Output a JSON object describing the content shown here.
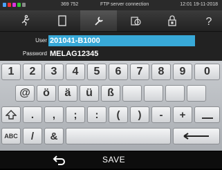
{
  "status": {
    "counter": "369 752",
    "title": "FTP server connection",
    "clock": "12:01  19-11-2018",
    "led_colors": [
      "#4aa3ff",
      "#e33",
      "#d3d",
      "#3c3",
      "#888"
    ]
  },
  "tabs": [
    {
      "icon": "program-icon"
    },
    {
      "icon": "document-icon"
    },
    {
      "icon": "wrench-icon",
      "active": true
    },
    {
      "icon": "clock-docs-icon"
    },
    {
      "icon": "lock-icon"
    },
    {
      "icon": "help-icon"
    }
  ],
  "fields": {
    "user_label": "User",
    "user_value": "201041-B1000",
    "password_label": "Password",
    "password_value": "MELAG12345"
  },
  "keyboard": {
    "row1": [
      "1",
      "2",
      "3",
      "4",
      "5",
      "6",
      "7",
      "8",
      "9",
      "0"
    ],
    "row2": [
      "@",
      "ö",
      "ä",
      "ü",
      "ß"
    ],
    "row3": [
      ".",
      ",",
      ";",
      ":",
      "(",
      ")",
      "-",
      "+"
    ],
    "abc": "ABC",
    "slash": "/",
    "amp": "&"
  },
  "footer": {
    "save_label": "SAVE"
  },
  "colors": {
    "selected_field": "#38a9d8",
    "background": "#000000"
  }
}
